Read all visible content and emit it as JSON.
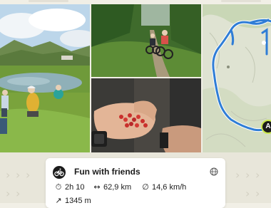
{
  "tour": {
    "title": "Fun with friends",
    "duration": "2h 10",
    "distance": "62,9 km",
    "speed": "14,6 km/h",
    "elevation": "1345 m"
  },
  "map": {
    "marker_label": "A"
  },
  "icons": {
    "sport": "mountain-bike-icon",
    "visibility": "globe-icon",
    "duration": "stopwatch-icon",
    "distance": "horizontal-arrows-icon",
    "speed": "speed-icon",
    "elevation": "uphill-arrow-icon"
  },
  "colors": {
    "route": "#2f7dd6",
    "accent": "#1b1b1b",
    "background": "#e8e6da"
  }
}
